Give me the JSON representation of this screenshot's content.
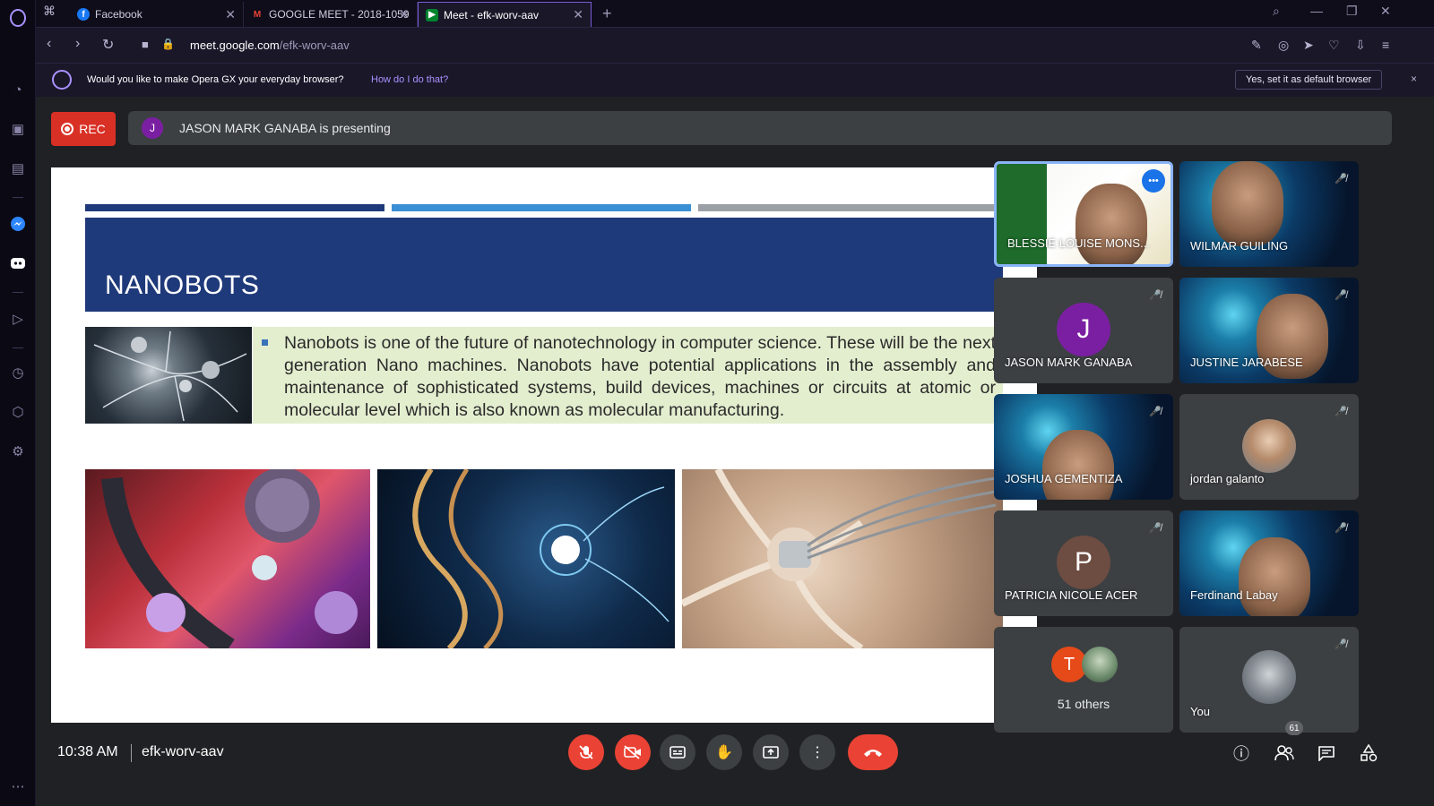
{
  "browser": {
    "tabs": [
      {
        "title": "Facebook"
      },
      {
        "title": "GOOGLE MEET - 2018-1059"
      },
      {
        "title": "Meet - efk-worv-aav"
      }
    ],
    "url_domain": "meet.google.com",
    "url_path": "/efk-worv-aav",
    "infobar": {
      "message": "Would you like to make Opera GX your everyday browser?",
      "link": "How do I do that?",
      "button": "Yes, set it as default browser",
      "close": "×"
    }
  },
  "meet": {
    "rec_label": "REC",
    "presenter_initial": "J",
    "presenting_text": "JASON MARK GANABA is presenting",
    "slide": {
      "title": "NANOBOTS",
      "body": "Nanobots is one of the future of nanotechnology in computer science. These will be the next generation Nano machines. Nanobots have potential applications in the assembly and maintenance of sophisticated systems, build devices, machines or circuits at atomic or molecular level which is also known as molecular manufacturing."
    },
    "participants": [
      {
        "name": "BLESSIE LOUISE MONS..."
      },
      {
        "name": "WILMAR GUILING"
      },
      {
        "name": "JASON MARK GANABA",
        "initial": "J"
      },
      {
        "name": "JUSTINE JARABESE"
      },
      {
        "name": "JOSHUA GEMENTIZA"
      },
      {
        "name": "jordan galanto"
      },
      {
        "name": "PATRICIA NICOLE ACER",
        "initial": "P"
      },
      {
        "name": "Ferdinand Labay"
      },
      {
        "name": "51 others",
        "initial": "T"
      },
      {
        "name": "You"
      }
    ],
    "clock": "10:38 AM",
    "meeting_code": "efk-worv-aav",
    "people_count": "61"
  },
  "colors": {
    "accent": "#7a5bd8",
    "rec_red": "#d93025",
    "slide_title_bg": "#1f3a7a",
    "slide_text_bg": "#e3eecf",
    "end_call": "#ea4335"
  }
}
